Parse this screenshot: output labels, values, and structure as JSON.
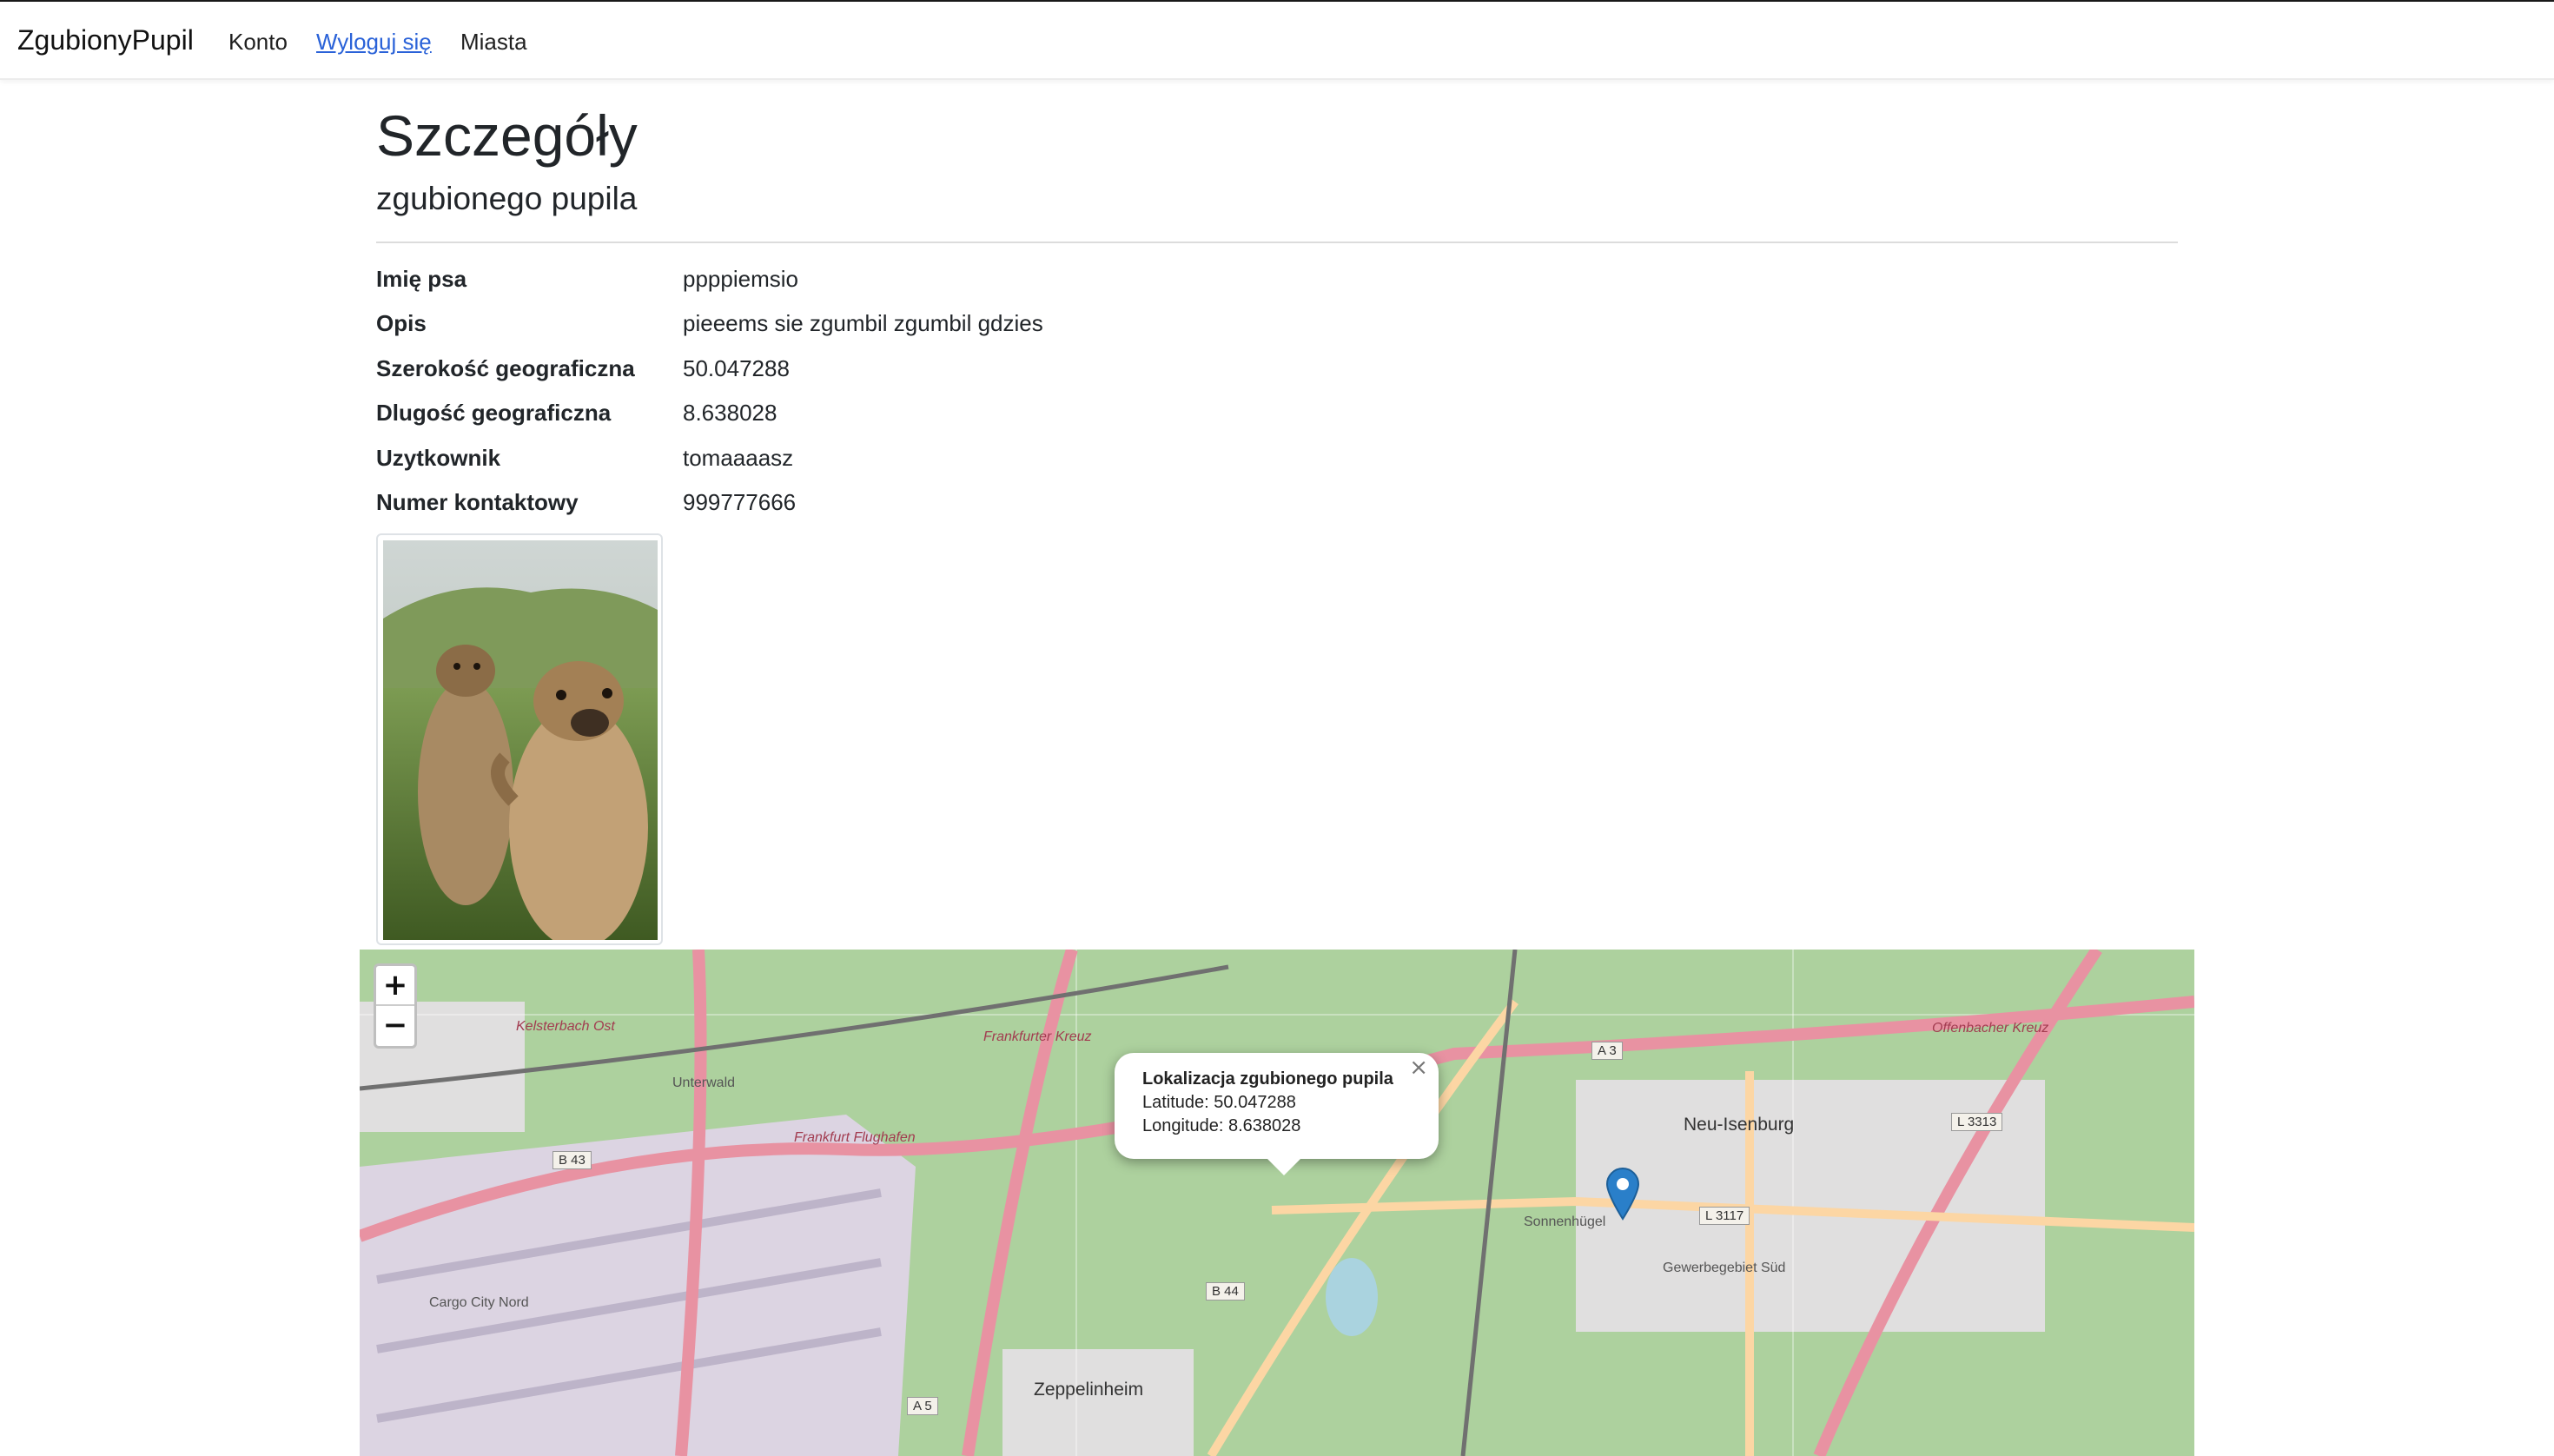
{
  "navbar": {
    "brand": "ZgubionyPupil",
    "links": [
      {
        "label": "Konto"
      },
      {
        "label": "Wyloguj się"
      },
      {
        "label": "Miasta"
      }
    ]
  },
  "page": {
    "title": "Szczegóły",
    "subtitle": "zgubionego pupila"
  },
  "details": [
    {
      "label": "Imię psa",
      "value": "ppppiemsio"
    },
    {
      "label": "Opis",
      "value": "pieeems sie zgumbil zgumbil gdzies"
    },
    {
      "label": "Szerokość geograficzna",
      "value": "50.047288"
    },
    {
      "label": "Dlugość geograficzna",
      "value": "8.638028"
    },
    {
      "label": "Uzytkownik",
      "value": "tomaaaasz"
    },
    {
      "label": "Numer kontaktowy",
      "value": "999777666"
    }
  ],
  "map": {
    "zoom_in": "+",
    "zoom_out": "−",
    "popup": {
      "title": "Lokalizacja zgubionego pupila",
      "latitude": "Latitude: 50.047288",
      "longitude": "Longitude: 8.638028",
      "close": "×"
    },
    "labels": {
      "neu_isenburg": "Neu-Isenburg",
      "zeppelinheim": "Zeppelinheim",
      "frankfurter_kreuz": "Frankfurter Kreuz",
      "frankfurt_flughafen": "Frankfurt Flughafen",
      "kelsterbach_ost": "Kelsterbach Ost",
      "unterwald": "Unterwald",
      "cargo_city": "Cargo City Nord",
      "gewerbegebiet_sud": "Gewerbegebiet Süd",
      "sonnenhugel": "Sonnenhügel",
      "offenbacher_kreuz": "Offenbacher Kreuz"
    },
    "shields": {
      "a3": "A 3",
      "a5": "A 5",
      "b43": "B 43",
      "b44": "B 44",
      "l3117": "L 3117",
      "l3313": "L 3313"
    },
    "marker_color": "#2a7fc9"
  }
}
